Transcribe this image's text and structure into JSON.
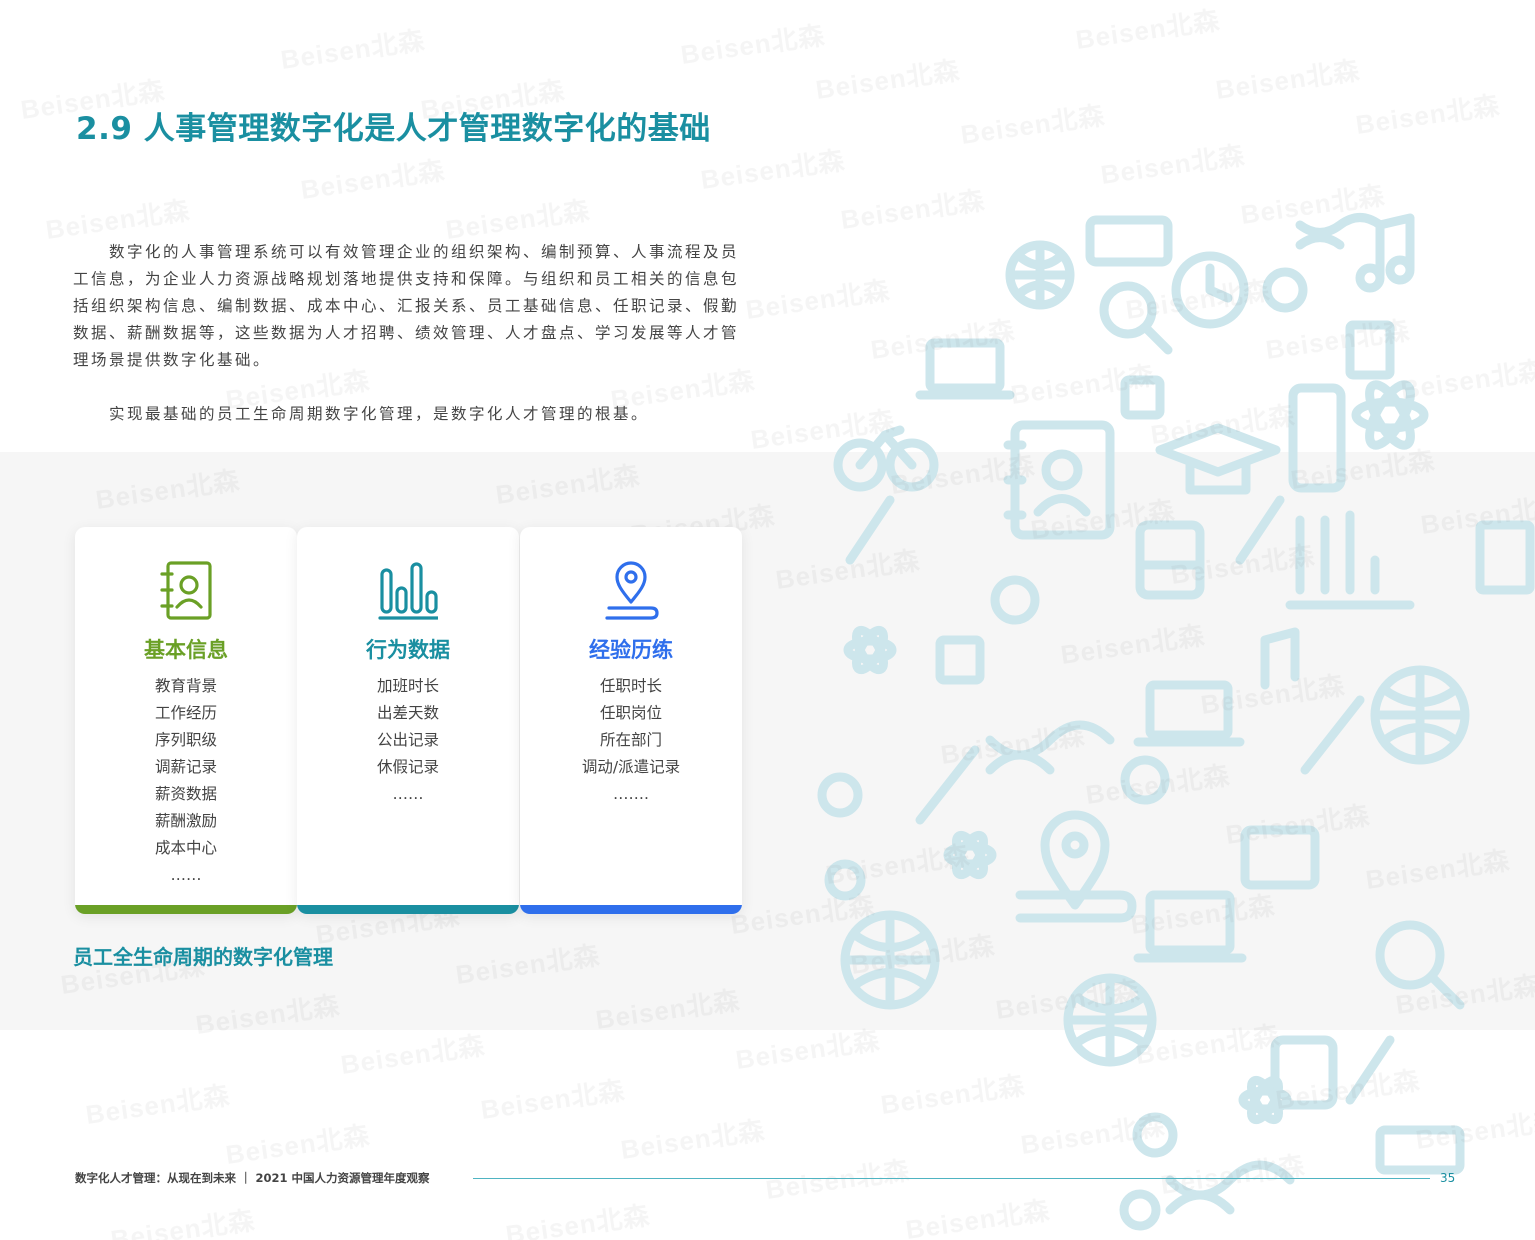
{
  "watermark": "Beisen北森",
  "title": "2.9 人事管理数字化是人才管理数字化的基础",
  "paragraphs": [
    "数字化的人事管理系统可以有效管理企业的组织架构、编制预算、人事流程及员工信息，为企业人力资源战略规划落地提供支持和保障。与组织和员工相关的信息包括组织架构信息、编制数据、成本中心、汇报关系、员工基础信息、任职记录、假勤数据、薪酬数据等，这些数据为人才招聘、绩效管理、人才盘点、学习发展等人才管理场景提供数字化基础。",
    "实现最基础的员工生命周期数字化管理，是数字化人才管理的根基。"
  ],
  "cards": [
    {
      "icon": "contact-book-icon",
      "title": "基本信息",
      "color": "#6aa026",
      "items": [
        "教育背景",
        "工作经历",
        "序列职级",
        "调薪记录",
        "薪资数据",
        "薪酬激励",
        "成本中心",
        "……"
      ]
    },
    {
      "icon": "bar-chart-icon",
      "title": "行为数据",
      "color": "#1a8fa1",
      "items": [
        "加班时长",
        "出差天数",
        "公出记录",
        "休假记录",
        "……"
      ]
    },
    {
      "icon": "location-pin-icon",
      "title": "经验历练",
      "color": "#2f6fec",
      "items": [
        "任职时长",
        "任职岗位",
        "所在部门",
        "调动/派遣记录",
        "……."
      ]
    }
  ],
  "caption": "员工全生命周期的数字化管理",
  "footer": {
    "text": "数字化人才管理：从现在到未来 ｜ 2021 中国人力资源管理年度观察",
    "page_number": "35"
  },
  "colors": {
    "accent": "#1a8fa1",
    "green": "#6aa026",
    "blue": "#2f6fec",
    "icon_cloud": "#cfe8ee"
  }
}
